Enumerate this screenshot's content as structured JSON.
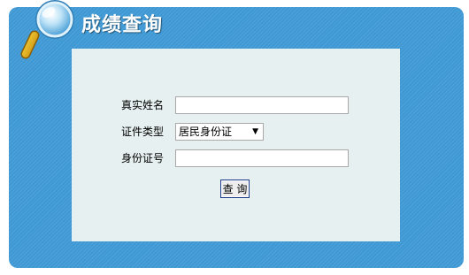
{
  "header": {
    "title": "成绩查询",
    "icon": "magnifier-icon"
  },
  "form": {
    "name_label": "真实姓名",
    "name_value": "",
    "id_type_label": "证件类型",
    "id_type_selected": "居民身份证",
    "id_number_label": "身份证号",
    "id_number_value": "",
    "submit_label": "查 询"
  },
  "colors": {
    "panel_blue": "#3d98d4",
    "form_background": "#e7f0f1",
    "title_text": "#ffffff"
  }
}
